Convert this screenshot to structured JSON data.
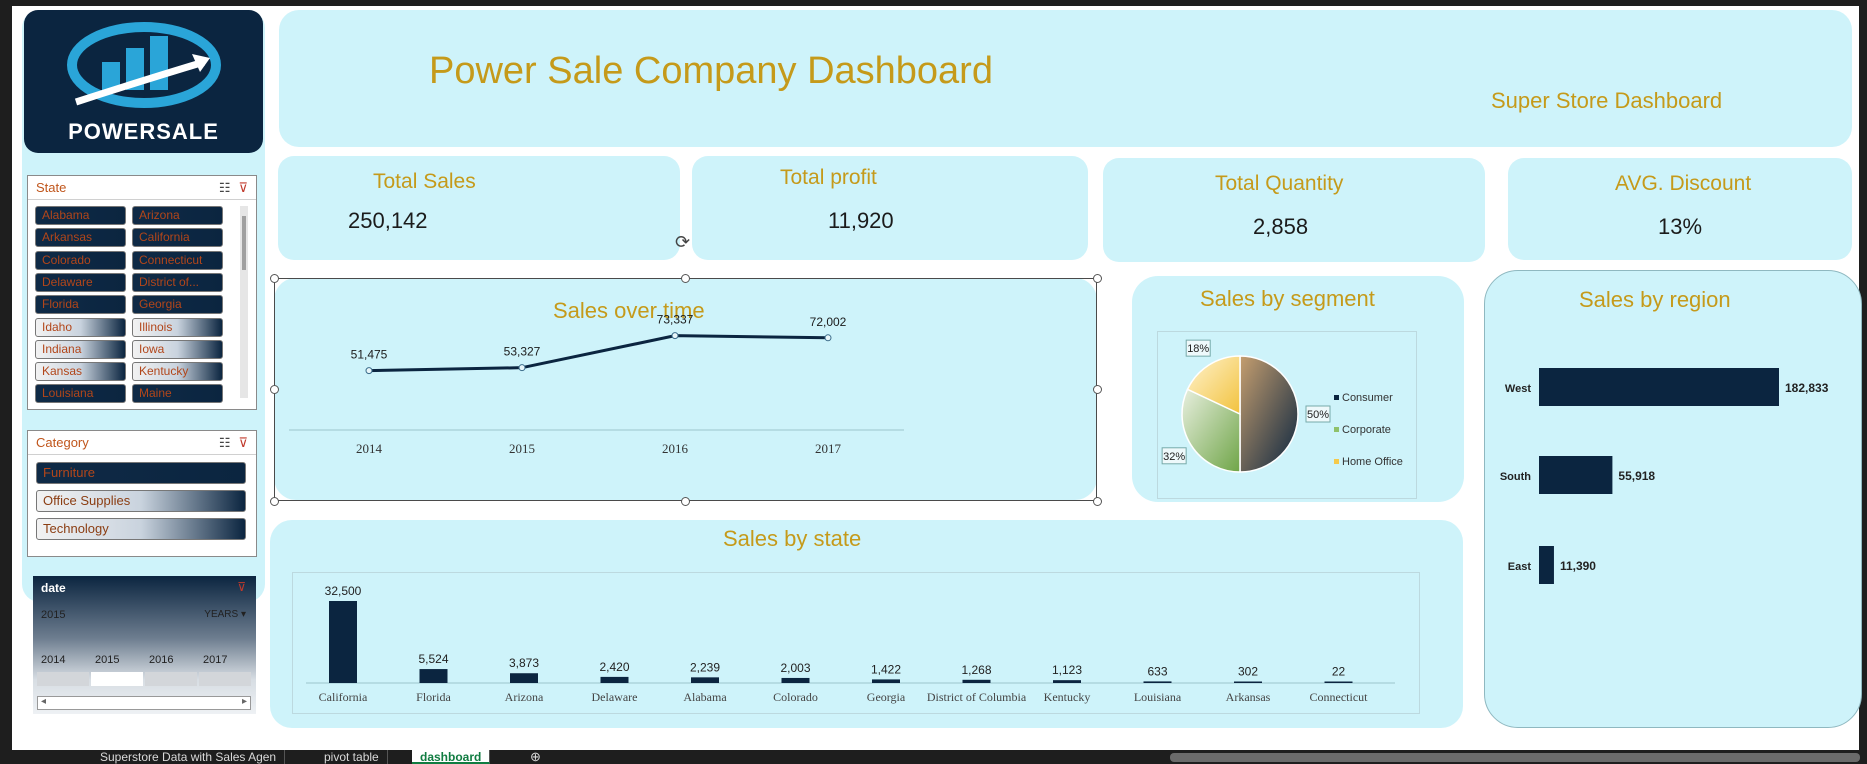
{
  "dashboard": {
    "title": "Power Sale Company Dashboard",
    "subtitle": "Super Store Dashboard"
  },
  "logo": {
    "text": "POWERSALE"
  },
  "kpis": {
    "sales": {
      "label": "Total Sales",
      "value": "250,142"
    },
    "profit": {
      "label": "Total profit",
      "value": "11,920"
    },
    "quantity": {
      "label": "Total Quantity",
      "value": "2,858"
    },
    "discount": {
      "label": "AVG. Discount",
      "value": "13%"
    }
  },
  "state_slicer": {
    "title": "State",
    "items": [
      "Alabama",
      "Arizona",
      "Arkansas",
      "California",
      "Colorado",
      "Connecticut",
      "Delaware",
      "District of...",
      "Florida",
      "Georgia",
      "Idaho",
      "Illinois",
      "Indiana",
      "Iowa",
      "Kansas",
      "Kentucky",
      "Louisiana",
      "Maine"
    ],
    "selected": [
      "Idaho",
      "Illinois",
      "Indiana",
      "Iowa",
      "Kansas",
      "Kentucky"
    ]
  },
  "category_slicer": {
    "title": "Category",
    "items": [
      "Furniture",
      "Office Supplies",
      "Technology"
    ],
    "selected": [
      "Office Supplies",
      "Technology"
    ]
  },
  "timeline": {
    "title": "date",
    "range_label": "2015",
    "level": "YEARS",
    "years": [
      "2014",
      "2015",
      "2016",
      "2017"
    ],
    "selected_year": "2015"
  },
  "chart_data": [
    {
      "type": "line",
      "title": "Sales over time",
      "x": [
        "2014",
        "2015",
        "2016",
        "2017"
      ],
      "values": [
        51475,
        53327,
        73337,
        72002
      ],
      "labels": [
        "51,475",
        "53,327",
        "73,337",
        "72,002"
      ],
      "color": "#0b2540"
    },
    {
      "type": "pie",
      "title": "Sales by segment",
      "categories": [
        "Consumer",
        "Corporate",
        "Home Office"
      ],
      "values": [
        50,
        32,
        18
      ],
      "labels": [
        "50%",
        "32%",
        "18%"
      ],
      "colors": [
        "#0b2540",
        "#8fc16a",
        "#f5c94a"
      ],
      "legend": "right"
    },
    {
      "type": "bar",
      "orientation": "horizontal",
      "title": "Sales by region",
      "categories": [
        "West",
        "South",
        "East"
      ],
      "values": [
        182833,
        55918,
        11390
      ],
      "labels": [
        "182,833",
        "55,918",
        "11,390"
      ],
      "color": "#0b2540"
    },
    {
      "type": "bar",
      "title": "Sales by state",
      "categories": [
        "California",
        "Florida",
        "Arizona",
        "Delaware",
        "Alabama",
        "Colorado",
        "Georgia",
        "District of Columbia",
        "Kentucky",
        "Louisiana",
        "Arkansas",
        "Connecticut"
      ],
      "values": [
        32500,
        5524,
        3873,
        2420,
        2239,
        2003,
        1422,
        1268,
        1123,
        633,
        302,
        22
      ],
      "labels": [
        "32,500",
        "5,524",
        "3,873",
        "2,420",
        "2,239",
        "2,003",
        "1,422",
        "1,268",
        "1,123",
        "633",
        "302",
        "22"
      ],
      "color": "#0b2540"
    }
  ],
  "sheet_tabs": [
    "Superstore Data with Sales Agen",
    "pivot table",
    "dashboard"
  ]
}
